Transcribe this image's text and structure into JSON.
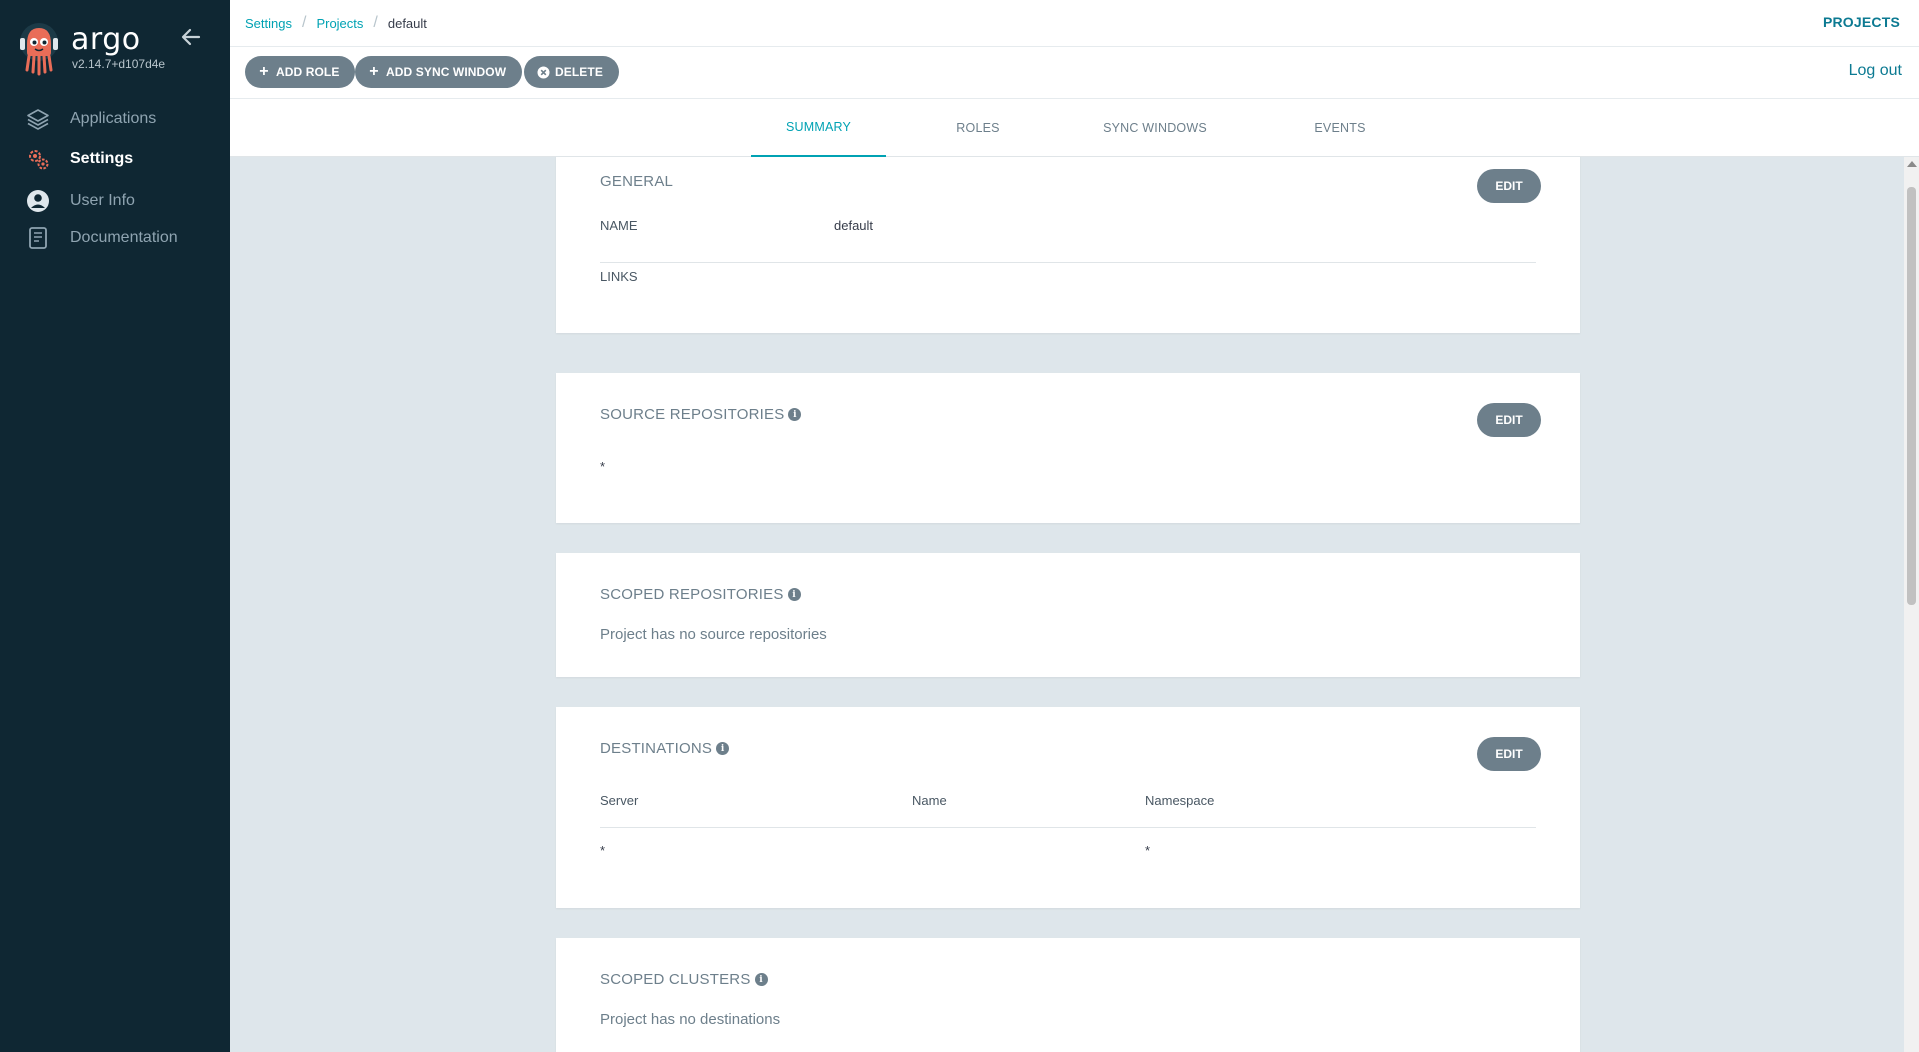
{
  "app": {
    "brand": "argo",
    "version": "v2.14.7+d107d4e"
  },
  "sidebar": {
    "items": [
      {
        "label": "Applications",
        "icon": "layers-icon"
      },
      {
        "label": "Settings",
        "icon": "gears-icon",
        "active": true
      },
      {
        "label": "User Info",
        "icon": "user-circle-icon"
      },
      {
        "label": "Documentation",
        "icon": "book-icon"
      }
    ]
  },
  "header": {
    "breadcrumb": [
      "Settings",
      "Projects",
      "default"
    ],
    "projects_label": "PROJECTS"
  },
  "toolbar": {
    "add_role": "ADD ROLE",
    "add_sync_window": "ADD SYNC WINDOW",
    "delete": "DELETE",
    "logout": "Log out"
  },
  "tabs": [
    "SUMMARY",
    "ROLES",
    "SYNC WINDOWS",
    "EVENTS"
  ],
  "general": {
    "title": "GENERAL",
    "edit": "EDIT",
    "name_label": "NAME",
    "name_value": "default",
    "links_label": "LINKS"
  },
  "source_repositories": {
    "title": "SOURCE REPOSITORIES",
    "edit": "EDIT",
    "items": [
      "*"
    ]
  },
  "scoped_repositories": {
    "title": "SCOPED REPOSITORIES",
    "empty": "Project has no source repositories"
  },
  "destinations": {
    "title": "DESTINATIONS",
    "edit": "EDIT",
    "columns": [
      "Server",
      "Name",
      "Namespace"
    ],
    "rows": [
      {
        "server": "*",
        "name": "",
        "namespace": "*"
      }
    ]
  },
  "scoped_clusters": {
    "title": "SCOPED CLUSTERS",
    "empty": "Project has no destinations"
  },
  "colors": {
    "sidebar_bg": "#0f2733",
    "accent": "#00a2b3",
    "button_gray": "#6d7f8b",
    "content_bg": "#dee6eb",
    "logo_orange": "#e96d58"
  }
}
